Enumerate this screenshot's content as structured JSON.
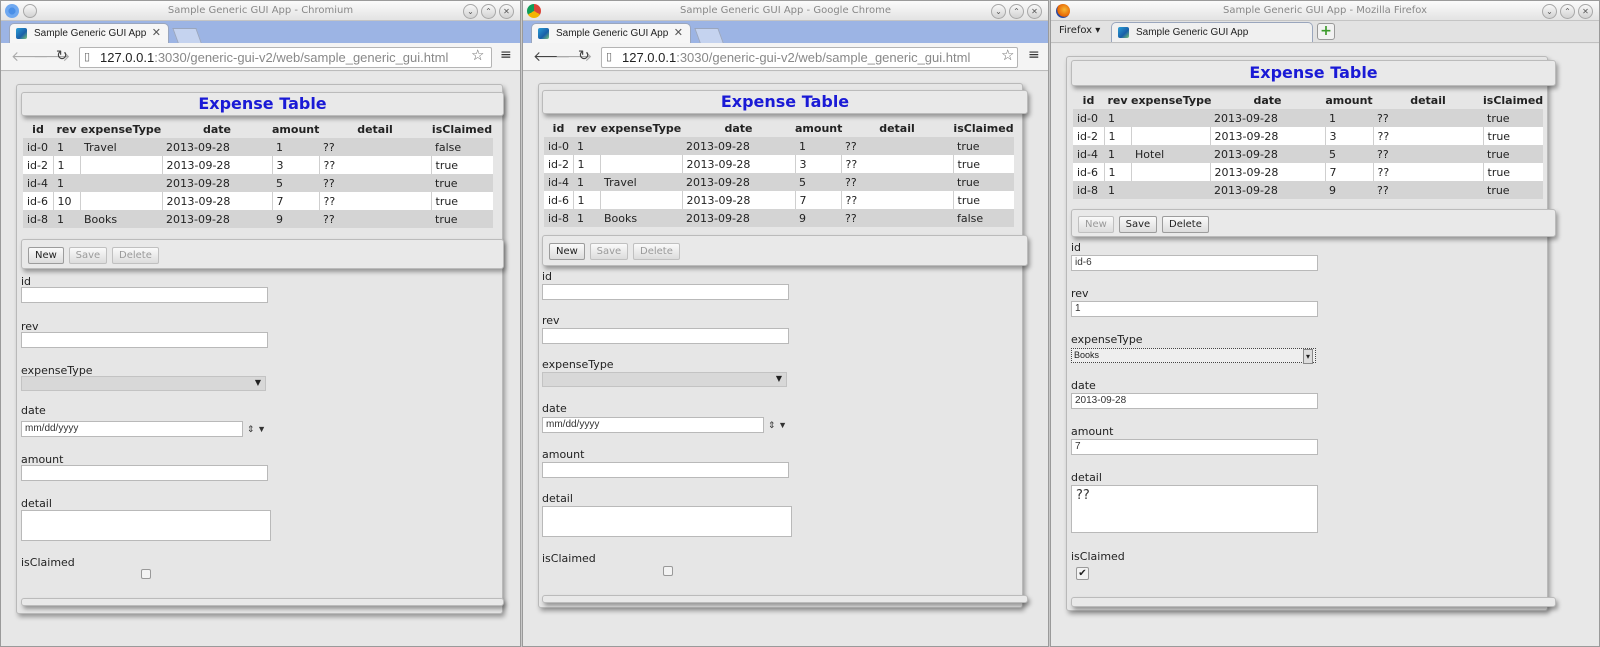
{
  "window_titles": [
    "Sample Generic GUI App - Chromium",
    "Sample Generic GUI App - Google Chrome",
    "Sample Generic GUI App - Mozilla Firefox"
  ],
  "tab_title": "Sample Generic GUI App",
  "url": {
    "host": "127.0.0.1",
    "rest": ":3030/generic-gui-v2/web/sample_generic_gui.html"
  },
  "firefox_menu": "Firefox",
  "table": {
    "title": "Expense Table",
    "columns": [
      "id",
      "rev",
      "expenseType",
      "date",
      "amount",
      "detail",
      "isClaimed"
    ]
  },
  "rows1": [
    [
      "id-0",
      "1",
      "Travel",
      "2013-09-28",
      "1",
      "??",
      "false"
    ],
    [
      "id-2",
      "1",
      "",
      "2013-09-28",
      "3",
      "??",
      "true"
    ],
    [
      "id-4",
      "1",
      "",
      "2013-09-28",
      "5",
      "??",
      "true"
    ],
    [
      "id-6",
      "10",
      "",
      "2013-09-28",
      "7",
      "??",
      "true"
    ],
    [
      "id-8",
      "1",
      "Books",
      "2013-09-28",
      "9",
      "??",
      "true"
    ]
  ],
  "rows2": [
    [
      "id-0",
      "1",
      "",
      "2013-09-28",
      "1",
      "??",
      "true"
    ],
    [
      "id-2",
      "1",
      "",
      "2013-09-28",
      "3",
      "??",
      "true"
    ],
    [
      "id-4",
      "1",
      "Travel",
      "2013-09-28",
      "5",
      "??",
      "true"
    ],
    [
      "id-6",
      "1",
      "",
      "2013-09-28",
      "7",
      "??",
      "true"
    ],
    [
      "id-8",
      "1",
      "Books",
      "2013-09-28",
      "9",
      "??",
      "false"
    ]
  ],
  "rows3": [
    [
      "id-0",
      "1",
      "",
      "2013-09-28",
      "1",
      "??",
      "true"
    ],
    [
      "id-2",
      "1",
      "",
      "2013-09-28",
      "3",
      "??",
      "true"
    ],
    [
      "id-4",
      "1",
      "Hotel",
      "2013-09-28",
      "5",
      "??",
      "true"
    ],
    [
      "id-6",
      "1",
      "",
      "2013-09-28",
      "7",
      "??",
      "true"
    ],
    [
      "id-8",
      "1",
      "",
      "2013-09-28",
      "9",
      "??",
      "true"
    ]
  ],
  "buttons": {
    "new": "New",
    "save": "Save",
    "delete": "Delete"
  },
  "form": {
    "id": "id",
    "rev": "rev",
    "expenseType": "expenseType",
    "date": "date",
    "amount": "amount",
    "detail": "detail",
    "isClaimed": "isClaimed"
  },
  "date_placeholder": "mm/dd/yyyy",
  "ff_values": {
    "id": "id-6",
    "rev": "1",
    "expenseType": "Books",
    "date": "2013-09-28",
    "amount": "7",
    "detail": "??"
  }
}
